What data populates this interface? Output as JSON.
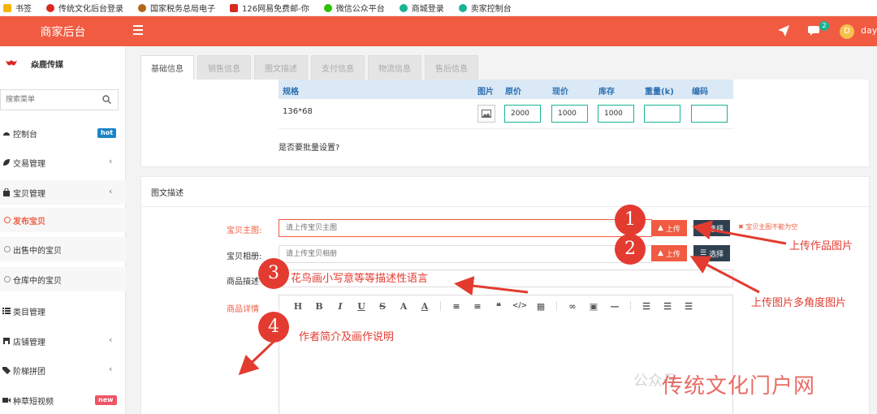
{
  "bookmarks": [
    {
      "label": "书签",
      "color": "#f5b400"
    },
    {
      "label": "传统文化后台登录",
      "color": "#d9281f"
    },
    {
      "label": "国家税务总局电子",
      "color": "#b5651d"
    },
    {
      "label": "126网易免费邮-你",
      "color": "#d9281f"
    },
    {
      "label": "微信公众平台",
      "color": "#2dc100"
    },
    {
      "label": "商城登录",
      "color": "#1ab394"
    },
    {
      "label": "卖家控制台",
      "color": "#1ab394"
    }
  ],
  "topbar": {
    "brand": "商家后台",
    "chat_badge": "2",
    "avatar_letter": "D",
    "username": "daya",
    "bg_color": "#f05b41"
  },
  "sidebar": {
    "store_name": "焱鹿传媒",
    "search_placeholder": "搜索菜单",
    "items": {
      "dashboard": {
        "label": "控制台",
        "tag": "hot"
      },
      "trade": {
        "label": "交易管理"
      },
      "goods": {
        "label": "宝贝管理"
      },
      "publish": {
        "label": "发布宝贝"
      },
      "on_sale": {
        "label": "出售中的宝贝"
      },
      "warehouse": {
        "label": "仓库中的宝贝"
      },
      "category": {
        "label": "类目管理"
      },
      "shop": {
        "label": "店铺管理"
      },
      "group_buy": {
        "label": "阶梯拼团"
      },
      "video": {
        "label": "种草短视频",
        "tag": "new"
      }
    }
  },
  "tabs": [
    "基础信息",
    "销售信息",
    "图文描述",
    "支付信息",
    "物流信息",
    "售后信息"
  ],
  "spec": {
    "headers": {
      "spec": "规格",
      "image": "图片",
      "orig_price": "原价",
      "cur_price": "现价",
      "stock": "库存",
      "weight": "重量(k)",
      "code": "编码"
    },
    "row": {
      "spec": "136*68",
      "orig_price": "2000",
      "cur_price": "1000",
      "stock": "1000",
      "weight": "",
      "code": ""
    },
    "bulk_question": "是否要批量设置?"
  },
  "desc": {
    "title": "图文描述",
    "main_image_label": "宝贝主图:",
    "main_image_placeholder": "请上传宝贝主图",
    "album_label": "宝贝相册:",
    "album_placeholder": "请上传宝贝相册",
    "goods_desc_label": "商品描述",
    "goods_desc_value": "花鸟画小写意等等描述性语言",
    "detail_label": "商品详情",
    "upload_label": "上传",
    "select_label": "选择",
    "error_msg": "宝贝主图不能为空"
  },
  "editor_toolbar": [
    "H",
    "B",
    "I",
    "U",
    "S",
    "A",
    "A"
  ],
  "annotations": {
    "n1": "1",
    "n2": "2",
    "n3": "3",
    "n4": "4",
    "t1": "上传作品图片",
    "t2": "上传图片多角度图片",
    "t4": "作者简介及画作说明"
  },
  "watermark": {
    "gray": "公众号",
    "red": "传统文化门户网"
  }
}
